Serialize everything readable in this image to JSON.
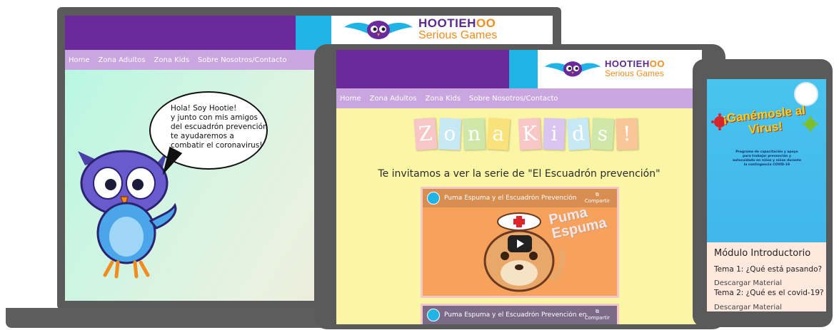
{
  "brand": {
    "name_part1": "HOOTIEH",
    "name_part2": "OO",
    "tagline": "Serious Games",
    "colors": {
      "purple": "#6a2a9c",
      "orange": "#f28c1e",
      "sky": "#1fb3e6",
      "nav": "#c9a6df"
    }
  },
  "nav": {
    "items": [
      "Home",
      "Zona Adultos",
      "Zona Kids",
      "Sobre Nosotros/Contacto"
    ]
  },
  "laptop": {
    "speech_lines": [
      "Hola! Soy Hootie!",
      "y junto con mis amigos",
      "del escuadrón prevención",
      "te ayudaremos a",
      "combatir el coronavirus!"
    ],
    "mascot_icon": "owl-mascot"
  },
  "tablet": {
    "banner_letters": [
      "Z",
      "o",
      "n",
      "a",
      "K",
      "i",
      "d",
      "s",
      "!"
    ],
    "banner_colors": [
      "#f8c6c6",
      "#c7e8f5",
      "#cfe7a8",
      "#f9e27a",
      "#f8c6c6",
      "#d9c5f0",
      "#c7e8f5",
      "#cfe7a8",
      "#f9c69a"
    ],
    "subtitle": "Te invitamos a ver la serie de \"El Escuadrón prevención\"",
    "videos": [
      {
        "title": "Puma Espuma y el Escuadrón Prevención",
        "share": "Compartir",
        "overlay": "Puma Espuma"
      },
      {
        "title": "Puma Espuma y el Escuadrón Prevención en.....",
        "share": "Compartir"
      }
    ]
  },
  "phone": {
    "hero_title": "¡Ganémosle al Virus!",
    "hero_desc": "Programa de capacitación y apoyo para trabajar prevención y autocuidado en niños y niñas durante la contingencia COVID-19",
    "module_title": "Módulo Introductorio",
    "lessons": [
      {
        "title": "Tema 1: ¿Qué está pasando?",
        "download": "Descargar Material"
      },
      {
        "title": "Tema 2: ¿Qué es el covid-19?",
        "download": "Descargar Material"
      }
    ]
  }
}
